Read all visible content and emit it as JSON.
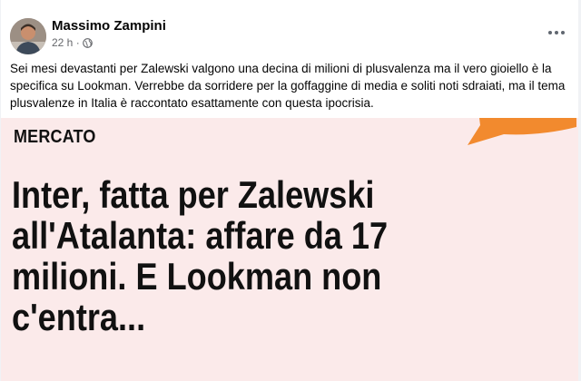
{
  "post": {
    "author": "Massimo Zampini",
    "time": "22 h ·",
    "privacy_icon": "globe-icon",
    "more_icon": "more-dots-icon",
    "text": "Sei mesi devastanti per Zalewski valgono una decina di milioni di plusvalenza ma il vero gioiello è la specifica su Lookman. Verrebbe da sorridere per la goffaggine di media e soliti noti sdraiati, ma il tema plusvalenze in Italia è raccontato esattamente con questa ipocrisia."
  },
  "image": {
    "category": "MERCATO",
    "headline_lines": [
      "Inter, fatta per Zalewski",
      "all'Atalanta: affare da 17",
      "milioni. E Lookman non",
      "c'entra..."
    ],
    "background_color": "#fbeaea",
    "accent_color": "#f28a2e"
  }
}
